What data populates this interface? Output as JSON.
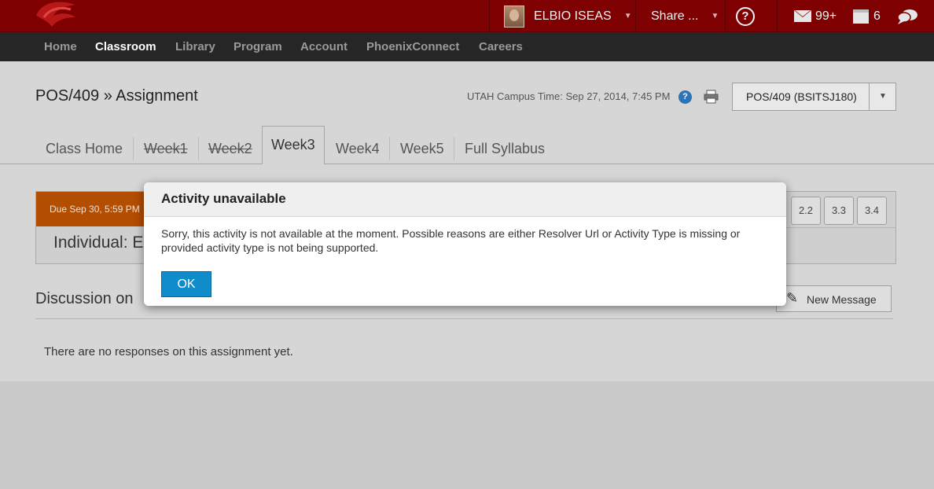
{
  "topbar": {
    "user_name": "ELBIO ISEAS",
    "share_label": "Share ...",
    "help_symbol": "?",
    "messages_count": "99+",
    "calendar_count": "6"
  },
  "nav": {
    "items": [
      "Home",
      "Classroom",
      "Library",
      "Program",
      "Account",
      "PhoenixConnect",
      "Careers"
    ],
    "active": "Classroom"
  },
  "page": {
    "breadcrumb": "POS/409 » Assignment",
    "campus_time": "UTAH Campus Time: Sep 27, 2014, 7:45 PM",
    "course_select": "POS/409 (BSITSJ180)"
  },
  "tabs": {
    "items": [
      "Class Home",
      "Week1",
      "Week2",
      "Week3",
      "Week4",
      "Week5",
      "Full Syllabus"
    ],
    "active": "Week3"
  },
  "assignment": {
    "due": "Due Sep 30, 5:59 PM",
    "title_visible": "Individual: E",
    "section_buttons": [
      "2.2",
      "3.3",
      "3.4"
    ]
  },
  "discussion": {
    "title_visible": "Discussion on",
    "new_message_label": "New Message",
    "empty_text": "There are no responses on this assignment yet."
  },
  "modal": {
    "title": "Activity unavailable",
    "message": "Sorry, this activity is not available at the moment. Possible reasons are either Resolver Url or Activity Type is missing or provided activity type is not being supported.",
    "ok_label": "OK"
  },
  "colors": {
    "topbar": "#7f0000",
    "navbar": "#262626",
    "due_badge": "#b34d00",
    "ok_button": "#0f8cc9"
  },
  "icons": [
    "phoenix-logo-icon",
    "caret-down-icon",
    "help-icon",
    "envelope-icon",
    "calendar-icon",
    "chat-bubbles-icon",
    "question-icon",
    "printer-icon",
    "pencil-icon"
  ]
}
